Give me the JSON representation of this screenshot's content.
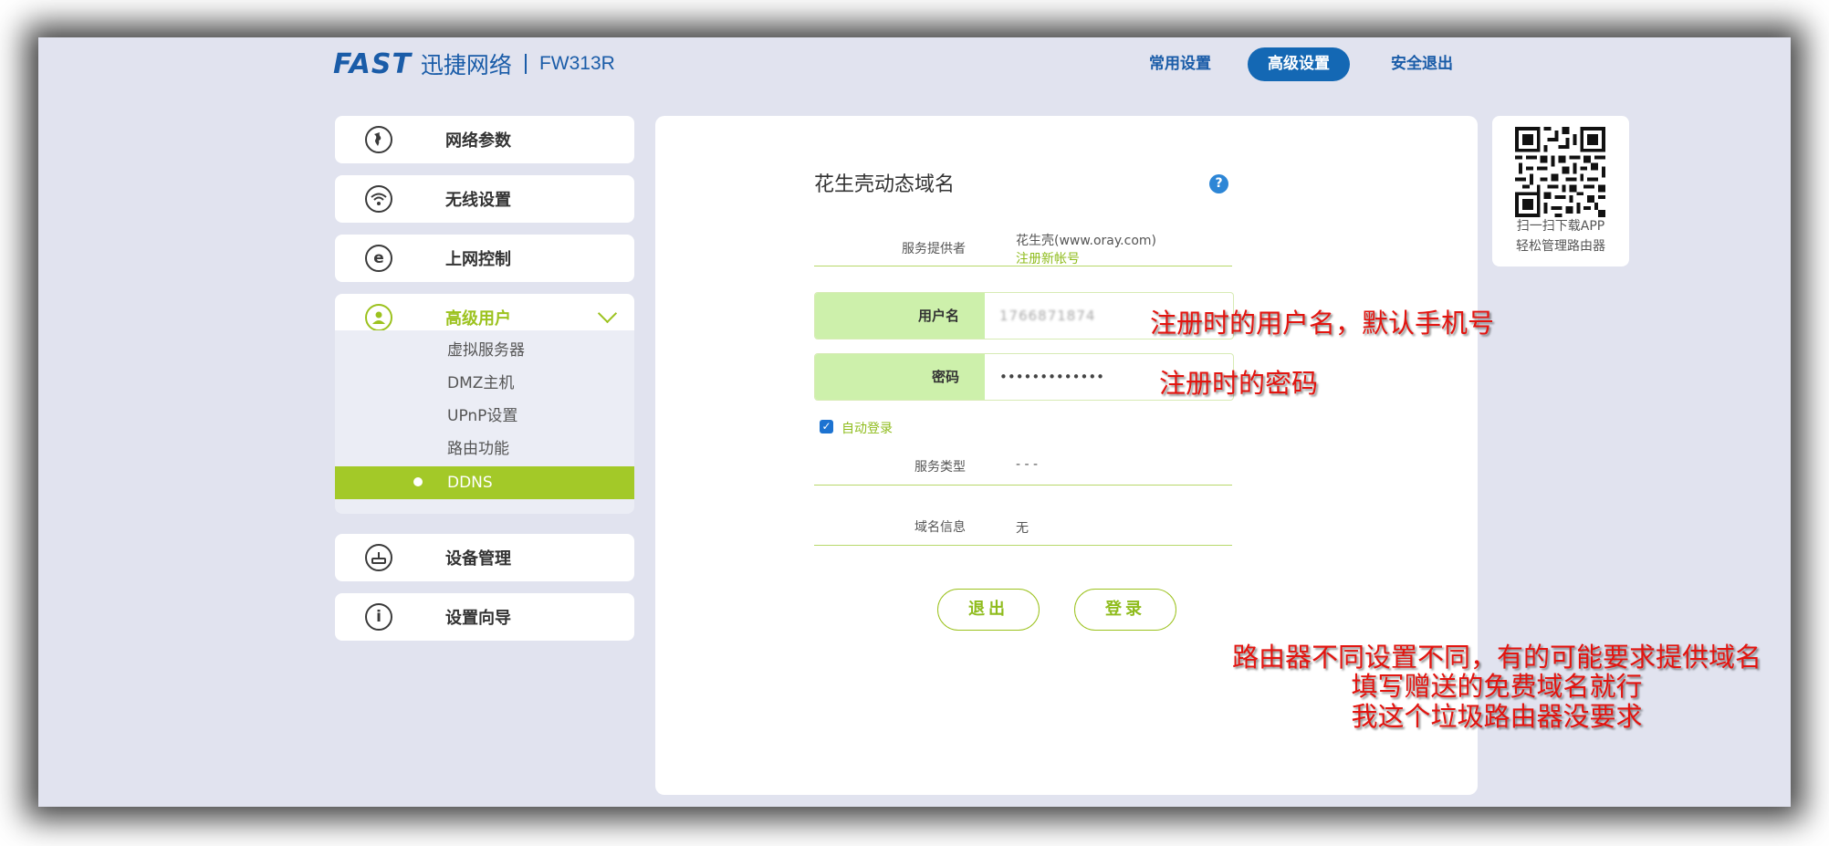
{
  "header": {
    "logo_brand": "FAST",
    "logo_cn": "迅捷网络",
    "model": "FW313R",
    "nav": [
      {
        "label": "常用设置",
        "active": false
      },
      {
        "label": "高级设置",
        "active": true
      },
      {
        "label": "安全退出",
        "active": false
      }
    ]
  },
  "sidebar": {
    "items": [
      {
        "label": "网络参数",
        "icon": "globe-icon"
      },
      {
        "label": "无线设置",
        "icon": "wifi-icon"
      },
      {
        "label": "上网控制",
        "icon": "browser-e-icon"
      },
      {
        "label": "高级用户",
        "icon": "user-icon"
      },
      {
        "label": "设备管理",
        "icon": "router-icon"
      },
      {
        "label": "设置向导",
        "icon": "info-icon"
      }
    ],
    "sub_items": [
      "虚拟服务器",
      "DMZ主机",
      "UPnP设置",
      "路由功能",
      "DDNS"
    ],
    "active_sub": "DDNS"
  },
  "ddns": {
    "title": "花生壳动态域名",
    "help": "?",
    "provider_label": "服务提供者",
    "provider_value": "花生壳(www.oray.com)",
    "register_link": "注册新帐号",
    "username_label": "用户名",
    "username_value": "1766871874",
    "password_label": "密码",
    "password_value": "•••••••••••••",
    "auto_login_label": "自动登录",
    "auto_login_checked": true,
    "service_type_label": "服务类型",
    "service_type_value": "- - -",
    "domain_info_label": "域名信息",
    "domain_info_value": "无",
    "logout_button": "退出",
    "login_button": "登录"
  },
  "qr": {
    "line1": "扫一扫下载APP",
    "line2": "轻松管理路由器"
  },
  "annotations": {
    "username_note": "注册时的用户名，默认手机号",
    "password_note": "注册时的密码",
    "note_line1": "路由器不同设置不同，有的可能要求提供域名",
    "note_line2": "填写赠送的免费域名就行",
    "note_line3": "我这个垃圾路由器没要求"
  },
  "colors": {
    "brand_blue": "#1a5ca8",
    "accent_green": "#a3c928",
    "annotation_red": "#e3140f"
  }
}
